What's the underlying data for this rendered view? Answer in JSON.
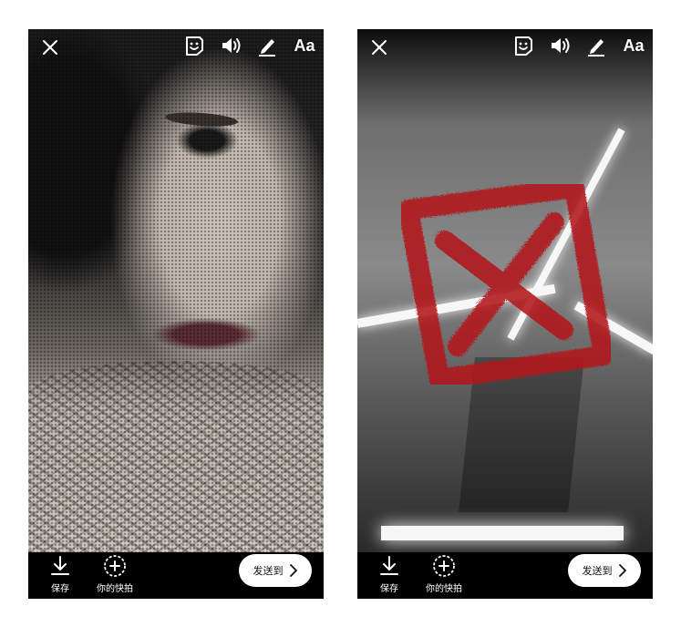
{
  "screens": [
    {
      "id": "left",
      "toolbar": {
        "text_tool": "Aa"
      },
      "bottom": {
        "save_label": "保存",
        "story_label": "你的快拍",
        "send_label": "发送到"
      },
      "icons": [
        "close-icon",
        "sticker-icon",
        "sound-icon",
        "pen-icon",
        "download-icon",
        "add-story-icon",
        "chevron-right-icon"
      ]
    },
    {
      "id": "right",
      "toolbar": {
        "text_tool": "Aa"
      },
      "bottom": {
        "save_label": "保存",
        "story_label": "你的快拍",
        "send_label": "发送到"
      },
      "sticker": {
        "icon": "x-box-icon",
        "color": "#b2191c"
      },
      "icons": [
        "close-icon",
        "sticker-icon",
        "sound-icon",
        "pen-icon",
        "download-icon",
        "add-story-icon",
        "chevron-right-icon"
      ]
    }
  ],
  "colors": {
    "background": "#ffffff",
    "bar": "#000000",
    "button": "#ffffff",
    "sticker_red": "#b2191c"
  }
}
